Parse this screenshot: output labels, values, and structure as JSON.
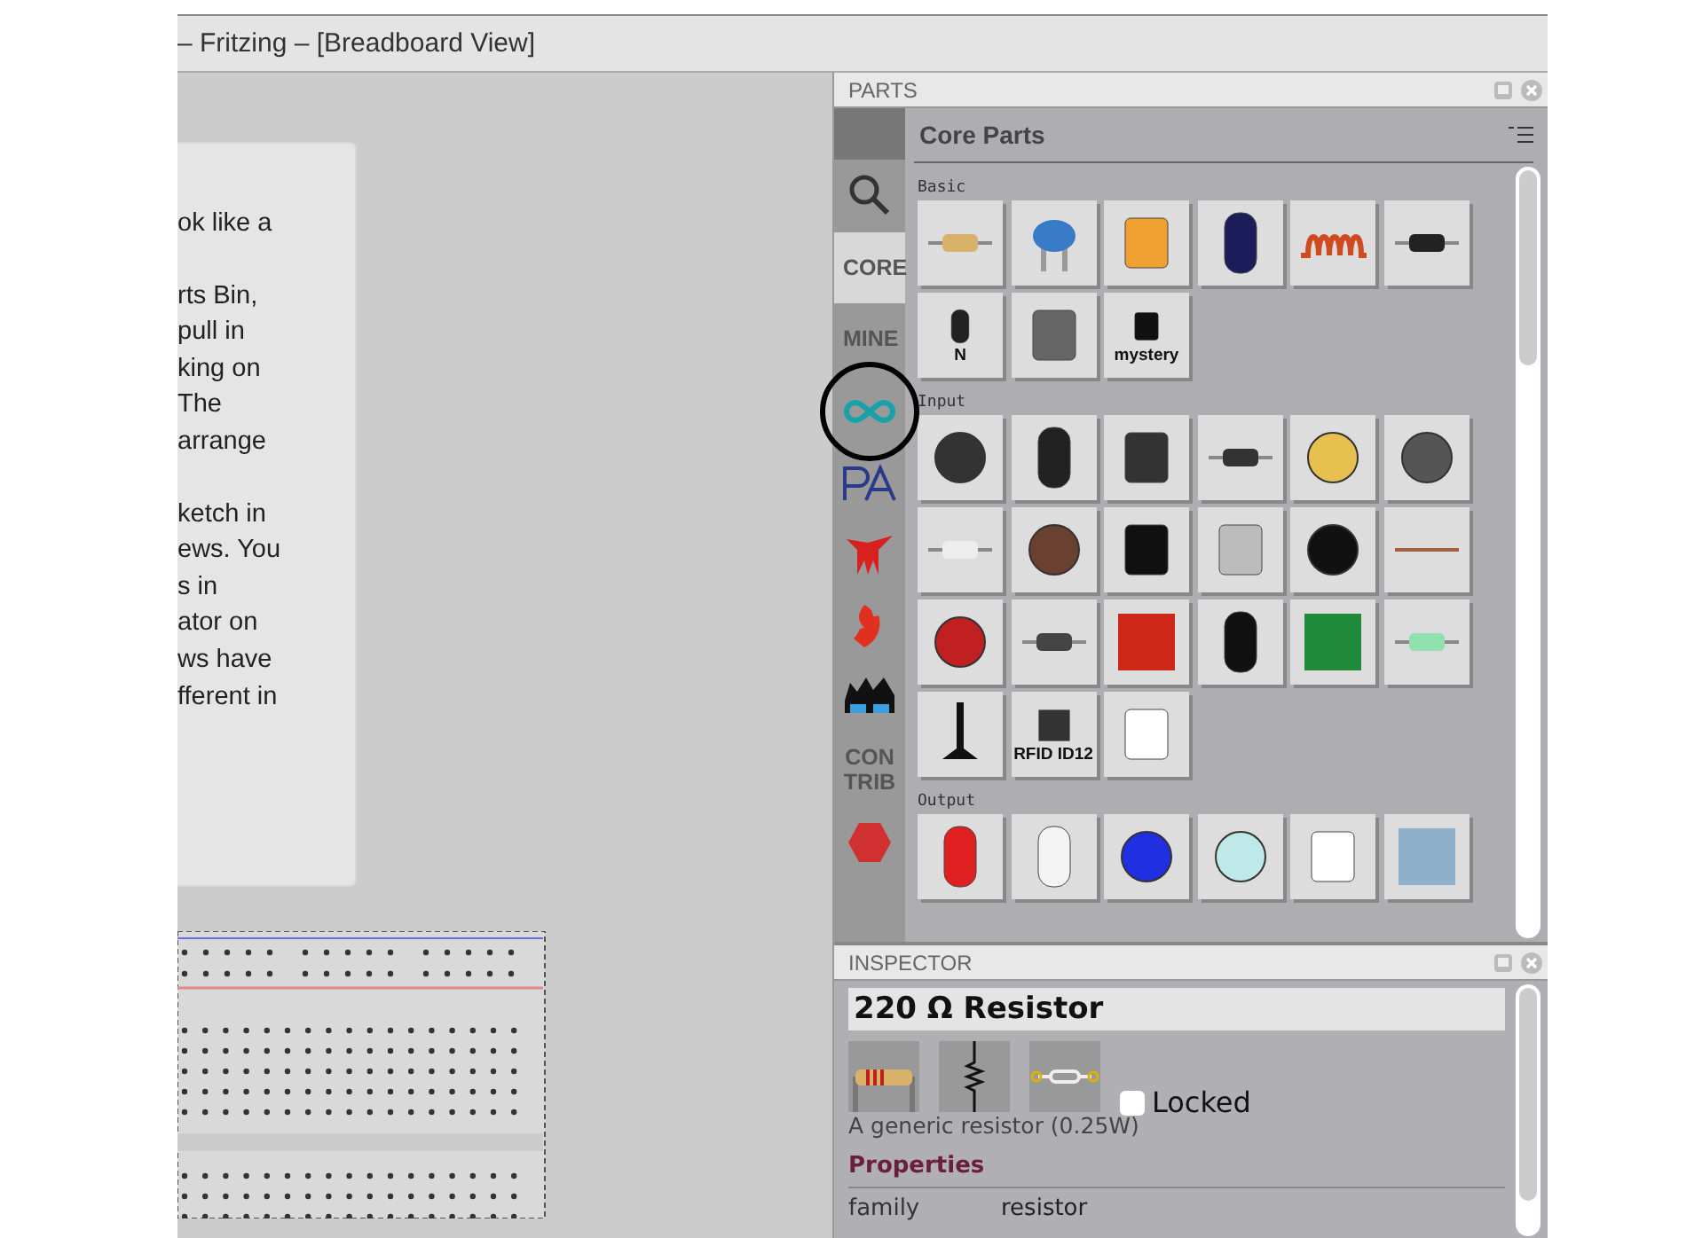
{
  "window": {
    "title": "– Fritzing – [Breadboard View]"
  },
  "help_text": {
    "paragraphs": [
      [
        "ok like a"
      ],
      [
        "rts Bin,",
        "pull in",
        "king on",
        "The",
        "arrange"
      ],
      [
        "ketch in",
        "ews. You",
        "s in",
        "ator on",
        "ws have",
        "fferent in"
      ]
    ]
  },
  "parts_panel": {
    "title": "PARTS",
    "bin_title": "Core Parts",
    "bins": [
      {
        "kind": "search",
        "selected": false
      },
      {
        "kind": "text",
        "label": "CORE",
        "selected": true
      },
      {
        "kind": "text",
        "label": "MINE",
        "selected": false
      },
      {
        "kind": "infinity",
        "selected": false,
        "circled": true
      },
      {
        "kind": "pa",
        "selected": false
      },
      {
        "kind": "bird",
        "selected": false
      },
      {
        "kind": "flame",
        "selected": false
      },
      {
        "kind": "goggles",
        "selected": false
      },
      {
        "kind": "text",
        "label": "CON TRIB",
        "selected": false
      },
      {
        "kind": "hexagon",
        "selected": false
      }
    ],
    "sections": [
      {
        "title": "Basic",
        "parts": [
          {
            "kind": "resistor"
          },
          {
            "kind": "ceramic"
          },
          {
            "kind": "tantalum"
          },
          {
            "kind": "electrolytic"
          },
          {
            "kind": "inductor"
          },
          {
            "kind": "diode"
          },
          {
            "kind": "transistor",
            "label": "N"
          },
          {
            "kind": "fet"
          },
          {
            "kind": "mystery",
            "label": "mystery"
          }
        ]
      },
      {
        "title": "Input",
        "parts": [
          {
            "kind": "encoder"
          },
          {
            "kind": "slider"
          },
          {
            "kind": "switch"
          },
          {
            "kind": "dip"
          },
          {
            "kind": "knob"
          },
          {
            "kind": "rotary"
          },
          {
            "kind": "small-button"
          },
          {
            "kind": "pushbutton"
          },
          {
            "kind": "slide-switch"
          },
          {
            "kind": "tilt"
          },
          {
            "kind": "fsr"
          },
          {
            "kind": "wire"
          },
          {
            "kind": "ldr"
          },
          {
            "kind": "ir"
          },
          {
            "kind": "red-board"
          },
          {
            "kind": "temp"
          },
          {
            "kind": "green-board"
          },
          {
            "kind": "reed"
          },
          {
            "kind": "stand"
          },
          {
            "kind": "rfid",
            "label": "RFID ID12"
          },
          {
            "kind": "humidity"
          }
        ]
      },
      {
        "title": "Output",
        "parts": [
          {
            "kind": "led-red"
          },
          {
            "kind": "led-white"
          },
          {
            "kind": "led-blue"
          },
          {
            "kind": "star"
          },
          {
            "kind": "seven-seg"
          },
          {
            "kind": "matrix"
          }
        ]
      }
    ]
  },
  "inspector": {
    "title": "INSPECTOR",
    "part_title": "220 Ω Resistor",
    "locked": {
      "label": "Locked",
      "checked": false
    },
    "description": "A generic resistor (0.25W)",
    "properties_title": "Properties",
    "properties": [
      {
        "name": "family",
        "value": "resistor"
      }
    ]
  }
}
